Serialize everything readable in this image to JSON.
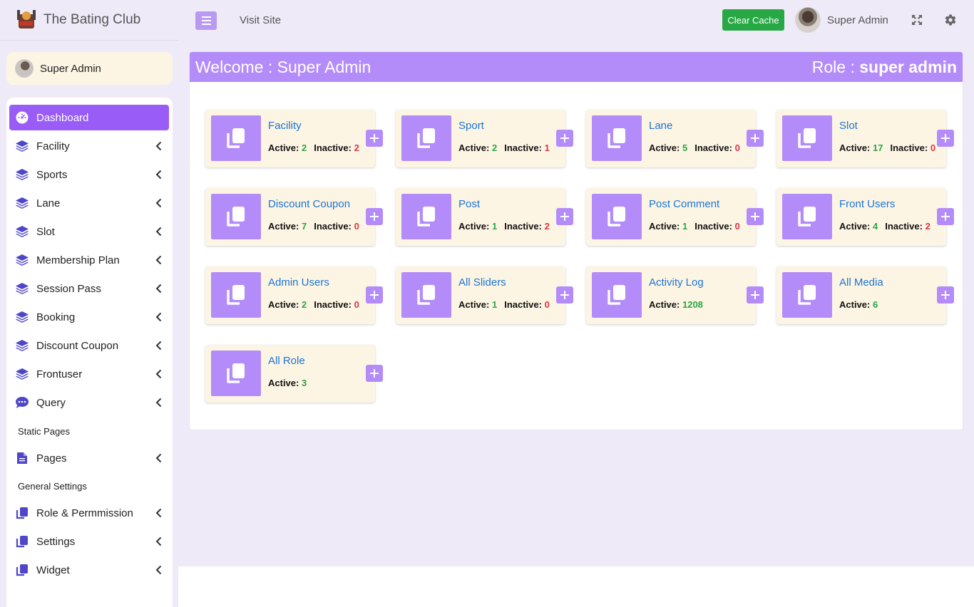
{
  "brand": {
    "name": "The Bating Club"
  },
  "user_panel": {
    "name": "Super Admin"
  },
  "sidebar": {
    "items": [
      {
        "label": "Dashboard",
        "icon": "dashboard-icon"
      },
      {
        "label": "Facility",
        "icon": "layers-icon"
      },
      {
        "label": "Sports",
        "icon": "layers-icon"
      },
      {
        "label": "Lane",
        "icon": "layers-icon"
      },
      {
        "label": "Slot",
        "icon": "layers-icon"
      },
      {
        "label": "Membership Plan",
        "icon": "layers-icon"
      },
      {
        "label": "Session Pass",
        "icon": "layers-icon"
      },
      {
        "label": "Booking",
        "icon": "layers-icon"
      },
      {
        "label": "Discount Coupon",
        "icon": "layers-icon"
      },
      {
        "label": "Frontuser",
        "icon": "layers-icon"
      },
      {
        "label": "Query",
        "icon": "chat-icon"
      },
      {
        "label": "Pages",
        "icon": "file-icon"
      },
      {
        "label": "Role & Permmission",
        "icon": "copy-icon"
      },
      {
        "label": "Settings",
        "icon": "copy-icon"
      },
      {
        "label": "Widget",
        "icon": "copy-icon"
      }
    ],
    "headers": {
      "static_pages": "Static Pages",
      "general_settings": "General Settings"
    }
  },
  "topbar": {
    "visit_site": "Visit Site",
    "clear_cache": "Clear Cache",
    "user_name": "Super Admin"
  },
  "welcome": {
    "prefix": "Welcome : Super Admin",
    "role_label": "Role : ",
    "role_value": "super admin"
  },
  "labels": {
    "active": "Active:",
    "inactive": "Inactive:"
  },
  "tiles": [
    {
      "title": "Facility",
      "active": "2",
      "inactive": "2"
    },
    {
      "title": "Sport",
      "active": "2",
      "inactive": "1"
    },
    {
      "title": "Lane",
      "active": "5",
      "inactive": "0"
    },
    {
      "title": "Slot",
      "active": "17",
      "inactive": "0"
    },
    {
      "title": "Discount Coupon",
      "active": "7",
      "inactive": "0"
    },
    {
      "title": "Post",
      "active": "1",
      "inactive": "2"
    },
    {
      "title": "Post Comment",
      "active": "1",
      "inactive": "0"
    },
    {
      "title": "Front Users",
      "active": "4",
      "inactive": "2"
    },
    {
      "title": "Admin Users",
      "active": "2",
      "inactive": "0"
    },
    {
      "title": "All Sliders",
      "active": "1",
      "inactive": "0"
    },
    {
      "title": "Activity Log",
      "active": "1208"
    },
    {
      "title": "All Media",
      "active": "6"
    },
    {
      "title": "All Role",
      "active": "3"
    }
  ],
  "colors": {
    "accent": "#9a5cf7",
    "tile_bg": "#fdf5e4",
    "header": "#b48cf9",
    "active_green": "#28a745",
    "inactive_red": "#dc3545"
  }
}
